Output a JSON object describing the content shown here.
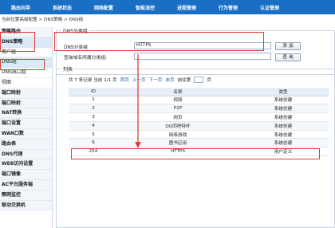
{
  "nav": {
    "tabs": [
      "路由向导",
      "系统状态",
      "网络配置",
      "智能流控",
      "进程管理",
      "行为管理",
      "认证管理"
    ]
  },
  "breadcrumb": {
    "label": "当前位置",
    "path": "高级配置 > DNS策略 > DNS组"
  },
  "sidebar": {
    "items": [
      {
        "label": "策略路由",
        "kind": "group"
      },
      {
        "label": "DNS策略",
        "kind": "group-active"
      },
      {
        "label": "用户组",
        "kind": "sub"
      },
      {
        "label": "DNS组",
        "kind": "sub-active"
      },
      {
        "label": "DNS出口组",
        "kind": "sub"
      },
      {
        "label": "视图",
        "kind": "sub"
      },
      {
        "label": "端口映射",
        "kind": "group"
      },
      {
        "label": "端口映射",
        "kind": "group"
      },
      {
        "label": "NAT转换",
        "kind": "group"
      },
      {
        "label": "端口设置",
        "kind": "group"
      },
      {
        "label": "WAN口数",
        "kind": "group"
      },
      {
        "label": "路由表",
        "kind": "group"
      },
      {
        "label": "DNS代理",
        "kind": "group"
      },
      {
        "label": "WEB访问设置",
        "kind": "group"
      },
      {
        "label": "端口镜像",
        "kind": "group"
      },
      {
        "label": "AC平台服务端",
        "kind": "group"
      },
      {
        "label": "察网监控",
        "kind": "group"
      },
      {
        "label": "联动交换机",
        "kind": "group"
      }
    ]
  },
  "dns_group": {
    "legend": "DNS分类组",
    "name_label": "DNS分类组",
    "name_value": "HTTPS",
    "add_button": "添 加",
    "query_label": "查询域名所属分类组:",
    "query_value": "",
    "query_button": "查 询"
  },
  "list": {
    "legend": "列表",
    "pager": {
      "summary": "共 7 条记录 当前 1/1 页",
      "first": "首页",
      "prev": "上一页",
      "next": "下一页",
      "last": "末页",
      "goto": "前往第",
      "page_unit": "页"
    },
    "columns": [
      "ID",
      "名称",
      "类型"
    ],
    "rows": [
      {
        "id": "1",
        "name": "视频",
        "type": "系统创建"
      },
      {
        "id": "2",
        "name": "P2P",
        "type": "系统创建"
      },
      {
        "id": "3",
        "name": "网页",
        "type": "系统创建"
      },
      {
        "id": "4",
        "name": "QQ同吧特杆",
        "type": "系统创建"
      },
      {
        "id": "5",
        "name": "网络游戏",
        "type": "系统创建"
      },
      {
        "id": "6",
        "name": "图书应用",
        "type": "系统创建"
      },
      {
        "id": "254",
        "name": "HTTPS",
        "type": "用户定义"
      }
    ]
  },
  "colors": {
    "nav_bg": "#1a6fc4",
    "highlight": "#e23a3a",
    "link": "#1a5fb4"
  }
}
